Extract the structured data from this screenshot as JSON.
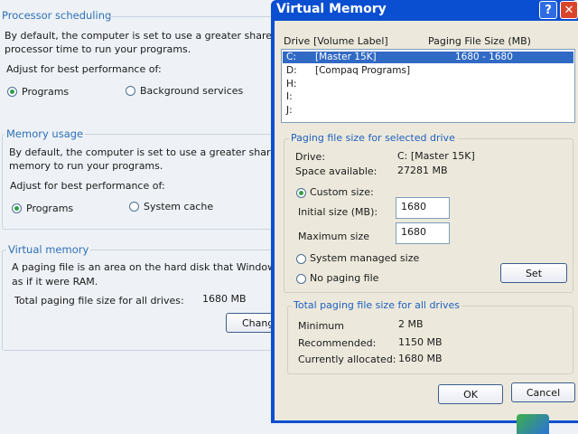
{
  "background": {
    "processor_scheduling": {
      "title": "Processor scheduling",
      "desc_line1": "By default, the computer is set to use a greater share of",
      "desc_line2": "processor time to run your programs.",
      "adjust_label": "Adjust for best performance of:",
      "option_programs": "Programs",
      "option_background": "Background services"
    },
    "memory_usage": {
      "title": "Memory usage",
      "desc_line1": "By default, the computer is set to use a greater share of",
      "desc_line2": "memory to run your programs.",
      "adjust_label": "Adjust for best performance of:",
      "option_programs": "Programs",
      "option_cache": "System cache"
    },
    "virtual_memory": {
      "title": "Virtual memory",
      "desc_line1": "A paging file is an area on the hard disk that Windows u",
      "desc_line2": "as if it were RAM.",
      "total_label": "Total paging file size for all drives:",
      "total_value": "1680 MB",
      "change_button": "Change"
    }
  },
  "dialog": {
    "title": "Virtual Memory",
    "help_glyph": "?",
    "close_glyph": "✕",
    "list_headers": {
      "drive": "Drive",
      "volume": "[Volume Label]",
      "paging": "Paging File Size (MB)"
    },
    "drives": [
      {
        "letter": "C:",
        "label": "[Master 15K]",
        "size": "1680 - 1680"
      },
      {
        "letter": "D:",
        "label": "[Compaq Programs]",
        "size": ""
      },
      {
        "letter": "H:",
        "label": "",
        "size": ""
      },
      {
        "letter": "I:",
        "label": "",
        "size": ""
      },
      {
        "letter": "J:",
        "label": "",
        "size": ""
      }
    ],
    "selected_group": {
      "title": "Paging file size for selected drive",
      "drive_label": "Drive:",
      "drive_value": "C: [Master 15K]",
      "space_label": "Space available:",
      "space_value": "27281 MB",
      "custom_size": "Custom size:",
      "initial_label": "Initial size (MB):",
      "initial_value": "1680",
      "maximum_label": "Maximum size",
      "maximum_value": "1680",
      "system_managed": "System managed size",
      "no_paging": "No paging file",
      "set_button": "Set"
    },
    "total_group": {
      "title": "Total paging file size for all drives",
      "minimum_label": "Minimum",
      "minimum_value": "2 MB",
      "recommended_label": "Recommended:",
      "recommended_value": "1150 MB",
      "allocated_label": "Currently allocated:",
      "allocated_value": "1680 MB"
    },
    "ok_button": "OK",
    "cancel_button": "Cancel"
  },
  "colors": {
    "title_bar": "#0a4fd1",
    "group_title": "#2e6fb7",
    "selection": "#316ac5",
    "radio_dot": "#2fa04a",
    "close_button": "#d9452b"
  }
}
